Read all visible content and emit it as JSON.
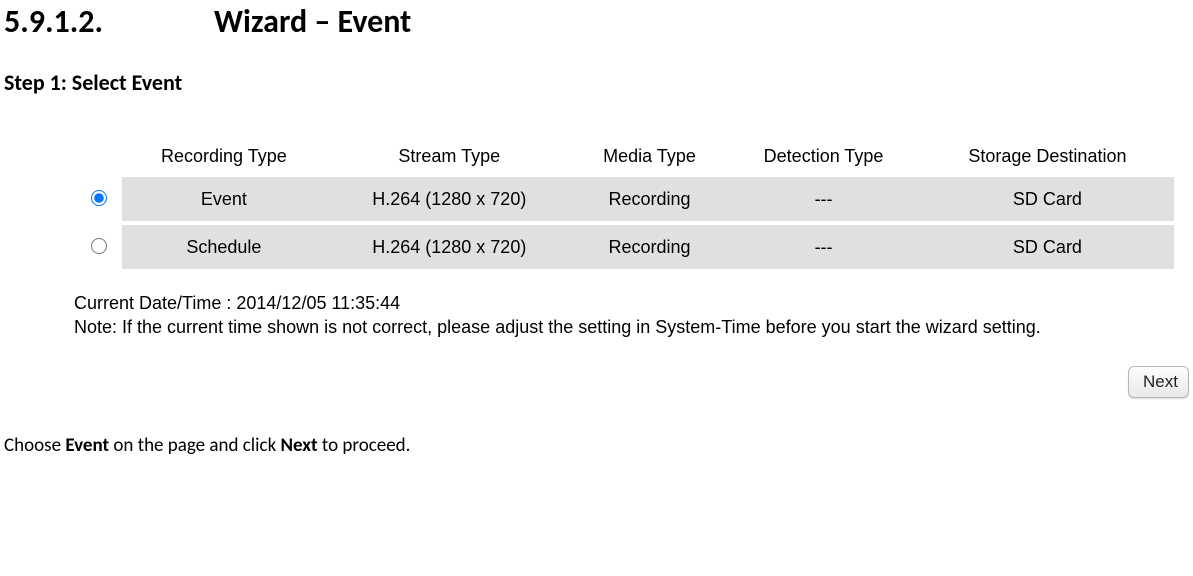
{
  "heading": {
    "number": "5.9.1.2.",
    "title": "Wizard – Event"
  },
  "step": "Step 1: Select Event",
  "table": {
    "headers": [
      "Recording Type",
      "Stream Type",
      "Media Type",
      "Detection Type",
      "Storage Destination"
    ],
    "rows": [
      {
        "selected": true,
        "cells": [
          "Event",
          "H.264 (1280 x 720)",
          "Recording",
          "---",
          "SD Card"
        ]
      },
      {
        "selected": false,
        "cells": [
          "Schedule",
          "H.264 (1280 x 720)",
          "Recording",
          "---",
          "SD Card"
        ]
      }
    ]
  },
  "datetime_line": "Current Date/Time : 2014/12/05 11:35:44",
  "note_line": "Note: If the current time shown is not correct, please adjust the setting in System-Time before you start the wizard setting.",
  "next_button": "Next",
  "instruction": {
    "pre": "Choose ",
    "b1": "Event",
    "mid": " on the page and click ",
    "b2": "Next",
    "post": " to proceed."
  }
}
